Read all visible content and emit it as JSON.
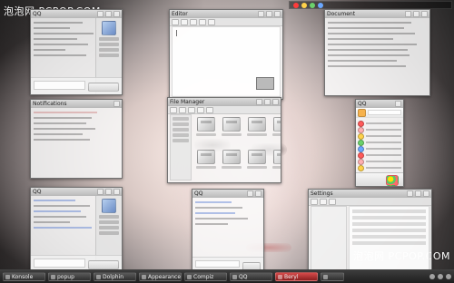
{
  "watermarks": {
    "top_left": "泡泡网 PCPOP.COM",
    "bottom_right": "泡泡网 PCPOP.COM"
  },
  "windows": {
    "w1": {
      "title": "QQ"
    },
    "w2": {
      "title": "Editor"
    },
    "w3": {
      "title": "Document"
    },
    "w4": {
      "title": "Notifications"
    },
    "w5": {
      "title": "File Manager"
    },
    "w6": {
      "title": "QQ"
    },
    "w7": {
      "title": "QQ"
    },
    "w8": {
      "title": "QQ"
    },
    "w9": {
      "title": "Settings"
    }
  },
  "taskbar": {
    "items": [
      {
        "label": "Konsole"
      },
      {
        "label": "popup"
      },
      {
        "label": "Dolphin"
      },
      {
        "label": "Appearance"
      },
      {
        "label": "Compiz"
      },
      {
        "label": "QQ"
      },
      {
        "label": "Beryl"
      },
      {
        "label": ""
      }
    ],
    "active_index": 6
  },
  "colors": {
    "accent": "#d64b4b",
    "taskbar_dark": "#1f1f1f"
  }
}
